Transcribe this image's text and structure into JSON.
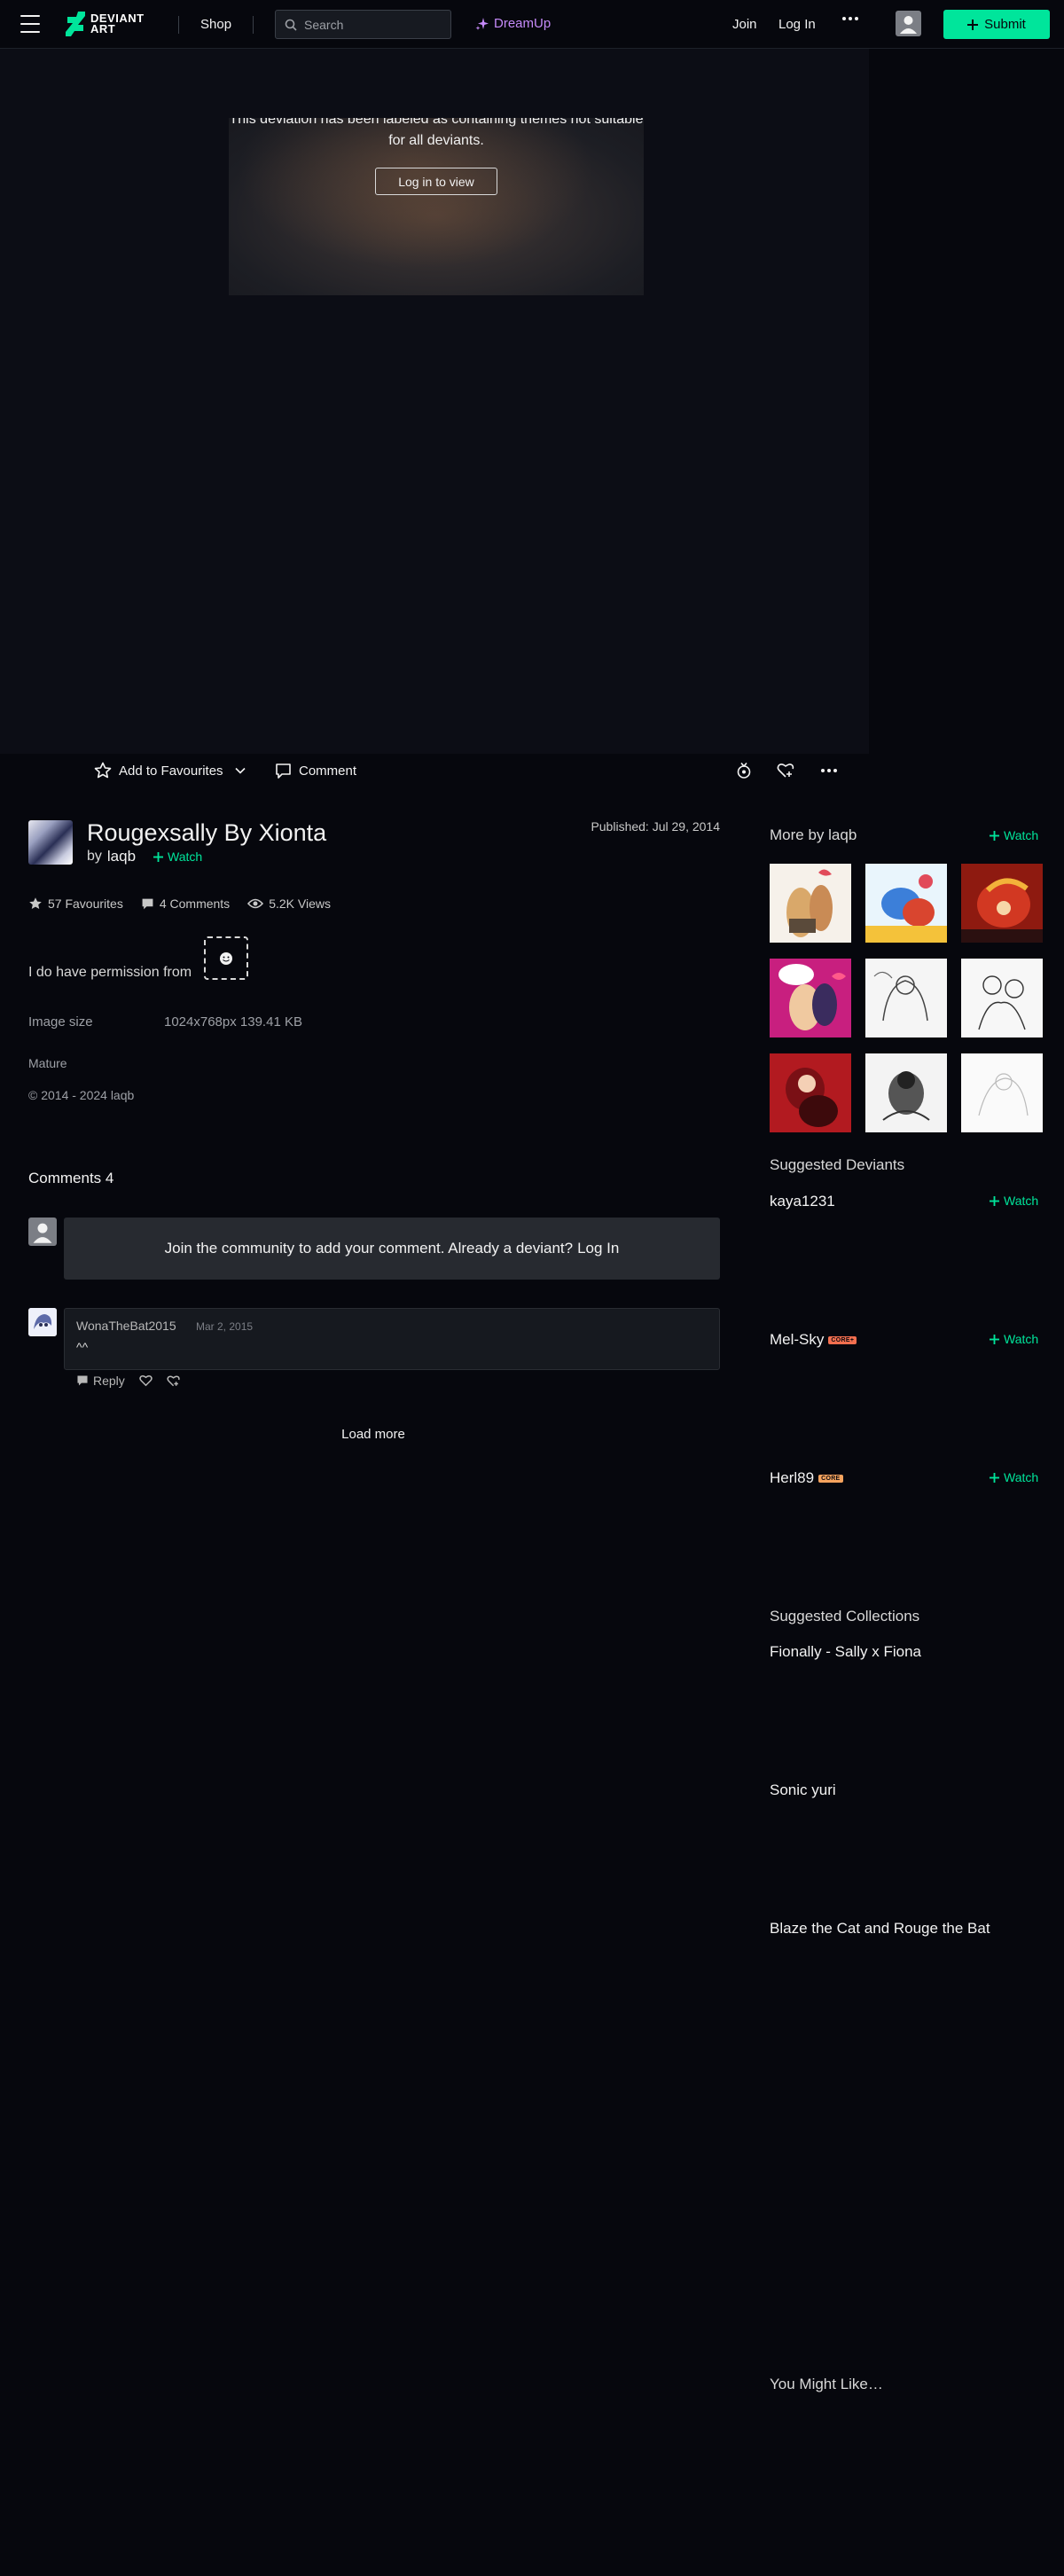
{
  "topbar": {
    "logo_text_line1": "DEVIANT",
    "logo_text_line2": "ART",
    "shop": "Shop",
    "search_placeholder": "Search",
    "dreamup": "DreamUp",
    "join": "Join",
    "login": "Log In",
    "submit": "Submit"
  },
  "stage": {
    "mature_message": "This deviation has been labeled as containing themes not suitable for all deviants.",
    "login_to_view": "Log in to view"
  },
  "actions": {
    "add_favourites": "Add to Favourites",
    "comment": "Comment"
  },
  "deviation": {
    "title": "Rougexsally By Xionta",
    "by": "by",
    "author": "laqb",
    "watch": "Watch",
    "published": "Published: Jul 29, 2014",
    "favourites": "57 Favourites",
    "comments": "4 Comments",
    "views": "5.2K Views",
    "description": "I do have permission from",
    "image_size_label": "Image size",
    "image_size_value": "1024x768px 139.41 KB",
    "mature": "Mature",
    "copyright": "© 2014 - 2024 laqb"
  },
  "comments": {
    "title": "Comments 4",
    "join_prefix": "Join the community",
    "join_middle": "to add your comment. Already a deviant?",
    "join_login": "Log In",
    "items": [
      {
        "author": "WonaTheBat2015",
        "date": "Mar 2, 2015",
        "body": "^^",
        "reply": "Reply"
      }
    ],
    "load_more": "Load more"
  },
  "sidebar": {
    "more_by": "More by laqb",
    "watch": "Watch",
    "suggested_deviants_title": "Suggested Deviants",
    "deviants": [
      {
        "name": "kaya1231",
        "badge": ""
      },
      {
        "name": "Mel-Sky",
        "badge": "CORE+"
      },
      {
        "name": "Herl89",
        "badge": "CORE"
      }
    ],
    "suggested_collections_title": "Suggested Collections",
    "collections": [
      "Fionally - Sally x Fiona",
      "Sonic yuri",
      "Blaze the Cat and Rouge the Bat"
    ],
    "you_might_like": "You Might Like…"
  },
  "colors": {
    "accent": "#00e59b",
    "dreamup": "#c58af9",
    "background": "#06070d",
    "core_plus": "#f36f4f",
    "core": "#f6a35e"
  }
}
